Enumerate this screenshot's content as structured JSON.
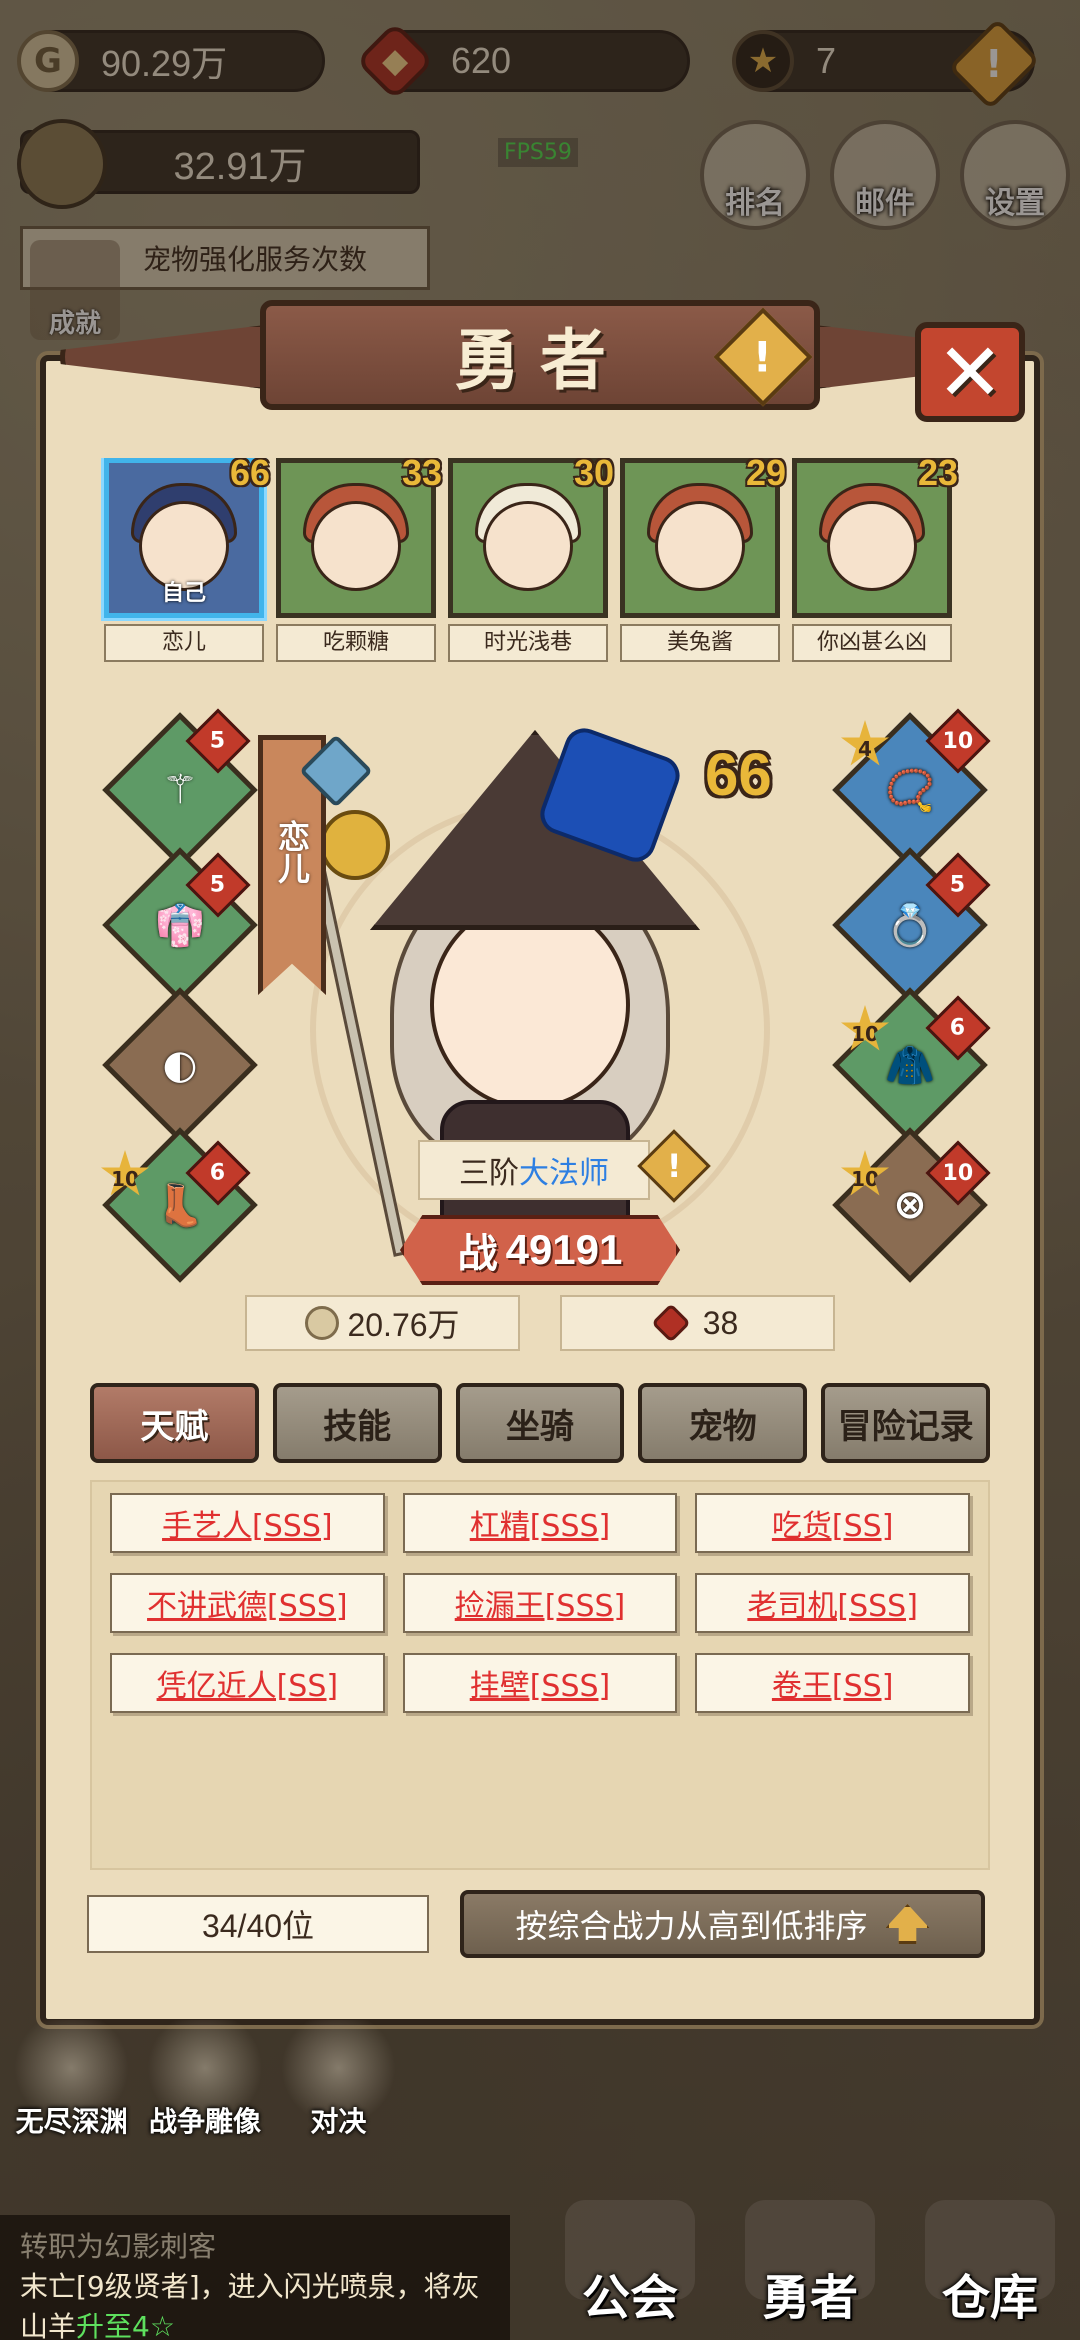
{
  "top_bar": {
    "gold": "90.29万",
    "gems": "620",
    "stars": "7",
    "warn_symbol": "!"
  },
  "power": "32.91万",
  "fps": "FPS59",
  "top_buttons": [
    {
      "label": "排名"
    },
    {
      "label": "邮件"
    },
    {
      "label": "设置"
    }
  ],
  "pet_service": "宠物强化服务次数",
  "achievement": "成就",
  "panel": {
    "title": "勇者",
    "close_symbol": "✕",
    "warn_symbol": "!"
  },
  "heroes": [
    {
      "name": "恋儿",
      "level": "66",
      "self_tag": "自己",
      "selected": true
    },
    {
      "name": "吃颗糖",
      "level": "33"
    },
    {
      "name": "时光浅巷",
      "level": "30"
    },
    {
      "name": "美兔酱",
      "level": "29"
    },
    {
      "name": "你凶甚么凶",
      "level": "23"
    }
  ],
  "current_hero": {
    "name": "恋儿",
    "level": "66",
    "class_prefix": "三阶",
    "class_name": "大法师",
    "combat_label": "战",
    "combat_power": "49191",
    "gold": "20.76万",
    "gems": "38"
  },
  "equipment_left": [
    {
      "icon": "staff-icon",
      "badge": "5"
    },
    {
      "icon": "robe-icon",
      "badge": "5"
    },
    {
      "icon": "hood-icon"
    },
    {
      "icon": "boots-icon",
      "star": "10",
      "badge": "6"
    }
  ],
  "equipment_right": [
    {
      "icon": "necklace-icon",
      "star": "4",
      "badge": "10"
    },
    {
      "icon": "ring-icon",
      "badge": "5"
    },
    {
      "icon": "cape-icon",
      "star": "10",
      "badge": "6"
    },
    {
      "icon": "belt-icon",
      "star": "10",
      "badge": "10"
    }
  ],
  "tabs": [
    {
      "label": "天赋",
      "active": true
    },
    {
      "label": "技能"
    },
    {
      "label": "坐骑"
    },
    {
      "label": "宠物"
    },
    {
      "label": "冒险记录"
    }
  ],
  "talents": [
    "手艺人[SSS]",
    "杠精[SSS]",
    "吃货[SS]",
    "不讲武德[SSS]",
    "捡漏王[SSS]",
    "老司机[SSS]",
    "凭亿近人[SS]",
    "挂壁[SSS]",
    "卷王[SS]"
  ],
  "footer": {
    "slot_count": "34/40位",
    "sort_label": "按综合战力从高到低排序"
  },
  "bottom_icons": [
    {
      "label": "无尽深渊"
    },
    {
      "label": "战争雕像"
    },
    {
      "label": "对决"
    }
  ],
  "chat": {
    "line1": "转职为幻影刺客",
    "line2": "末亡[9级贤者]，进入闪光喷泉，将灰",
    "line3_prefix": "山羊",
    "line3_highlight": "升至4☆"
  },
  "nav": [
    {
      "label": "公会"
    },
    {
      "label": "勇者"
    },
    {
      "label": "仓库"
    }
  ]
}
